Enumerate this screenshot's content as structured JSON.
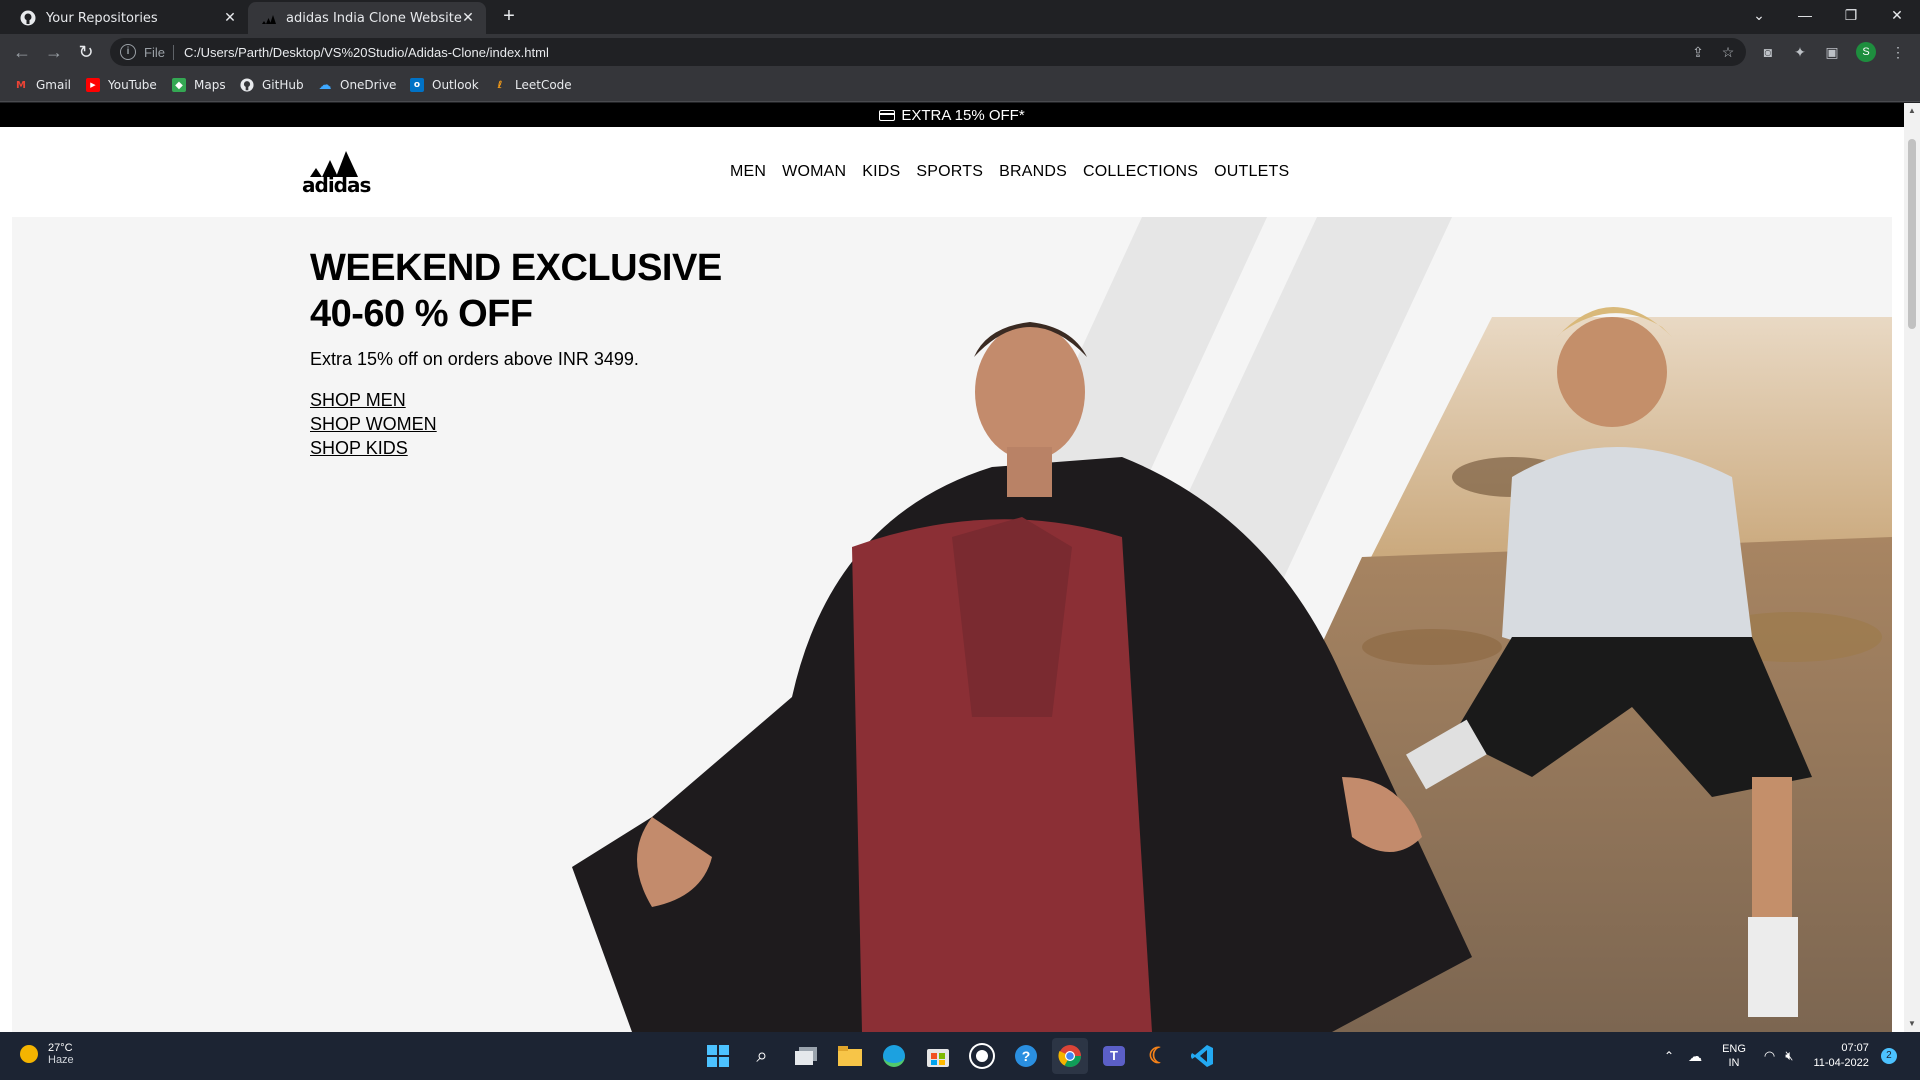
{
  "browser": {
    "tabs": [
      {
        "title": "Your Repositories",
        "icon": "github-icon",
        "active": false
      },
      {
        "title": "adidas India Clone Website",
        "icon": "adidas-icon",
        "active": true
      }
    ],
    "url_scheme_label": "File",
    "url": "C:/Users/Parth/Desktop/VS%20Studio/Adidas-Clone/index.html",
    "profile_initial": "S",
    "bookmarks": [
      {
        "label": "Gmail",
        "icon": "gmail-icon",
        "color": "#ea4335"
      },
      {
        "label": "YouTube",
        "icon": "youtube-icon",
        "color": "#ff0000"
      },
      {
        "label": "Maps",
        "icon": "maps-icon",
        "color": "#34a853"
      },
      {
        "label": "GitHub",
        "icon": "github-icon",
        "color": "#ffffff"
      },
      {
        "label": "OneDrive",
        "icon": "onedrive-icon",
        "color": "#0078d4"
      },
      {
        "label": "Outlook",
        "icon": "outlook-icon",
        "color": "#0072c6"
      },
      {
        "label": "LeetCode",
        "icon": "leetcode-icon",
        "color": "#ffa116"
      }
    ]
  },
  "site": {
    "promo_text": "EXTRA 15% OFF*",
    "logo_text": "adidas",
    "nav": [
      "MEN",
      "WOMAN",
      "KIDS",
      "SPORTS",
      "BRANDS",
      "COLLECTIONS",
      "OUTLETS"
    ],
    "hero": {
      "title_line1": "WEEKEND EXCLUSIVE",
      "title_line2": "40-60 % OFF",
      "subtitle": "Extra 15% off on orders above INR 3499.",
      "links": [
        "SHOP MEN",
        "SHOP WOMEN",
        "SHOP KIDS"
      ]
    }
  },
  "taskbar": {
    "weather_temp": "27°C",
    "weather_desc": "Haze",
    "lang": "ENG",
    "region": "IN",
    "time": "07:07",
    "date": "11-04-2022",
    "notification_count": "2"
  }
}
